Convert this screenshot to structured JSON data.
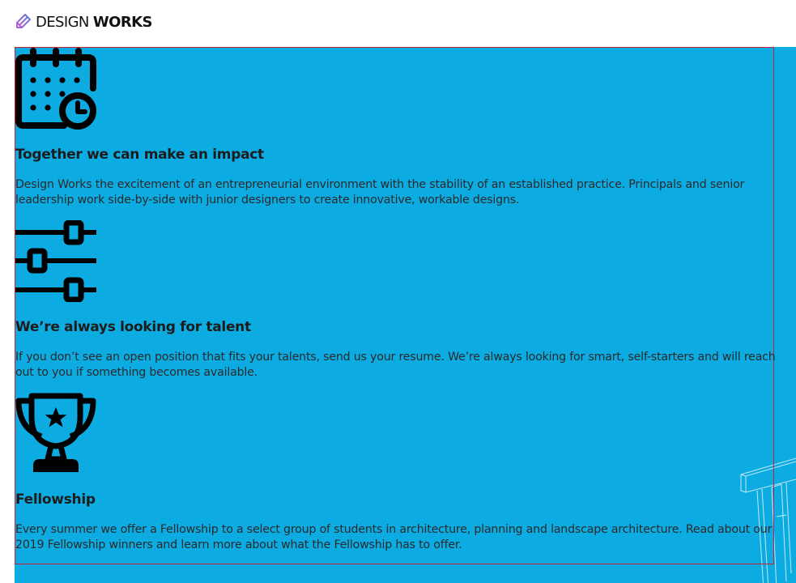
{
  "header": {
    "brand_light": "DESIGN",
    "brand_bold": "WORKS",
    "logo_icon": "pencil-ruler-logo-icon"
  },
  "colors": {
    "panel_background": "#0cabe2",
    "content_border": "#c6203a",
    "heading_text": "#1c1c1c",
    "body_text": "#2a2a2a"
  },
  "features": [
    {
      "icon": "calendar-clock-icon",
      "title": "Together we can make an impact",
      "body": "Design Works the excitement of an entrepreneurial environment with the stability of an established practice. Principals and senior leadership work side-by-side with junior designers to create innovative, workable designs."
    },
    {
      "icon": "sliders-icon",
      "title": "We’re always looking for talent",
      "body": "If you don’t see an open position that fits your talents, send us your resume. We’re always looking for smart, self-starters and will reach out to you if something becomes available."
    },
    {
      "icon": "trophy-icon",
      "title": "Fellowship",
      "body": "Every summer we offer a Fellowship to a select group of students in architecture, planning and landscape architecture. Read about our 2019 Fellowship winners and learn more about what the Fellowship has to offer."
    }
  ]
}
